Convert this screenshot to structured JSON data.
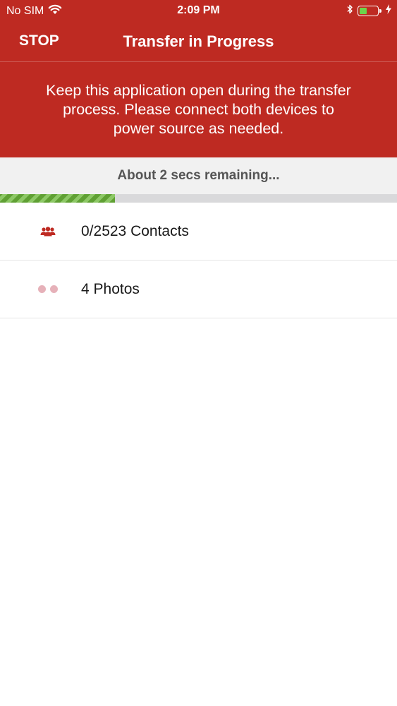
{
  "status_bar": {
    "carrier": "No SIM",
    "time": "2:09 PM",
    "battery_level": 0.45,
    "icons": [
      "wifi-icon",
      "bluetooth-icon",
      "battery-icon",
      "charging-bolt-icon"
    ]
  },
  "nav": {
    "stop_label": "STOP",
    "title": "Transfer in Progress"
  },
  "banner": {
    "message": "Keep this application open during the transfer process. Please connect both devices to power source as needed."
  },
  "progress": {
    "remaining_text": "About 2 secs remaining...",
    "fraction": 0.29
  },
  "items": [
    {
      "icon": "contacts-group-icon",
      "label": "0/2523 Contacts"
    },
    {
      "icon": "pending-dots-icon",
      "label": "4 Photos"
    }
  ],
  "colors": {
    "header_bg": "#be2a22",
    "progress_green": "#5fa033",
    "contacts_icon": "#be2a22",
    "pending_dots": "#e6b1b9"
  }
}
